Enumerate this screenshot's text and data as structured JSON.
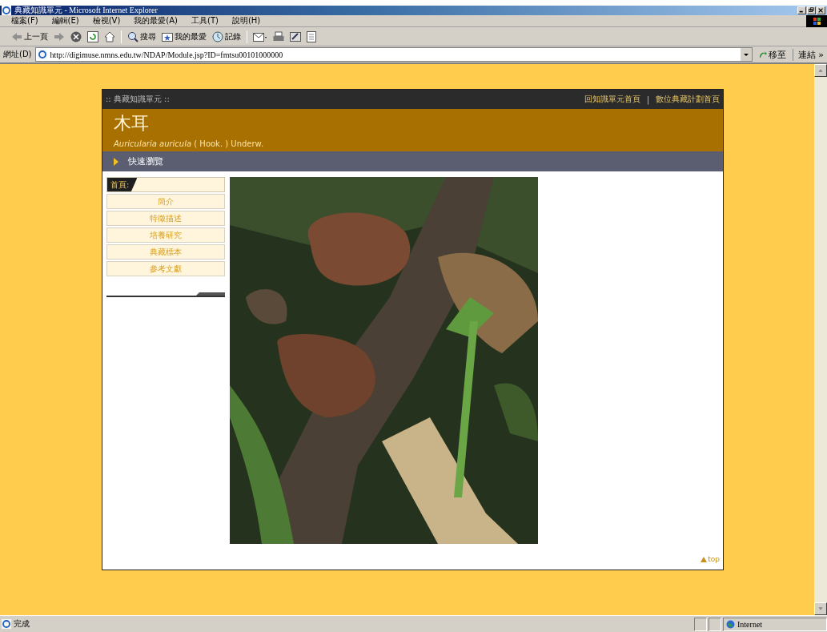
{
  "window": {
    "title": "典藏知識單元 - Microsoft Internet Explorer"
  },
  "menu": [
    "檔案(F)",
    "編輯(E)",
    "檢視(V)",
    "我的最愛(A)",
    "工具(T)",
    "說明(H)"
  ],
  "toolbar": [
    {
      "kind": "back",
      "label": "上一頁"
    },
    {
      "kind": "forward"
    },
    {
      "kind": "stop"
    },
    {
      "kind": "refresh"
    },
    {
      "kind": "home"
    },
    {
      "kind": "search",
      "label": "搜尋"
    },
    {
      "kind": "favorites",
      "label": "我的最愛"
    },
    {
      "kind": "history",
      "label": "記錄"
    },
    {
      "kind": "mail"
    },
    {
      "kind": "print"
    },
    {
      "kind": "edit"
    },
    {
      "kind": "discuss"
    }
  ],
  "address": {
    "label": "網址(D)",
    "value": "http://digimuse.nmns.edu.tw/NDAP/Module.jsp?ID=fmtsu00101000000",
    "go": "移至",
    "links": "連結 »"
  },
  "site": {
    "section": ":: 典藏知識單元 ::",
    "links": [
      "回知識單元首頁",
      "數位典藏計劃首頁"
    ],
    "separator": "|",
    "title": "木耳",
    "scientific": "*Auricularia auricula* ( Hook. ) Underw.",
    "quick": "快速瀏覽"
  },
  "sidebar": {
    "heading": "首頁:",
    "items": [
      "簡介",
      "特徵描述",
      "培養研究",
      "典藏標本",
      "參考文獻"
    ]
  },
  "top_link": "top",
  "status": {
    "text": "完成",
    "zone": "Internet"
  }
}
